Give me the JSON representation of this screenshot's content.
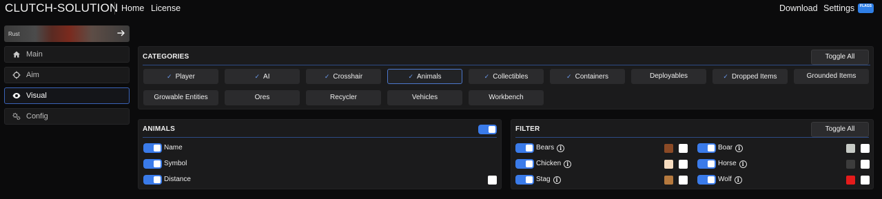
{
  "header": {
    "brand": "CLUTCH-SOLUTION",
    "nav_left": [
      "Home",
      "License"
    ],
    "nav_right": [
      "Download",
      "Settings"
    ],
    "language_flag_text": "FLAGS",
    "flag_color": "#2f7fe6"
  },
  "sidebar": {
    "game": {
      "name": "Rust",
      "action_icon": "arrow-right-icon"
    },
    "items": [
      {
        "label": "Main",
        "icon": "home-icon",
        "active": false
      },
      {
        "label": "Aim",
        "icon": "crosshair-icon",
        "active": false
      },
      {
        "label": "Visual",
        "icon": "eye-icon",
        "active": true
      },
      {
        "label": "Config",
        "icon": "gears-icon",
        "active": false
      }
    ]
  },
  "categories": {
    "title": "CATEGORIES",
    "toggle_all_label": "Toggle All",
    "items": [
      {
        "label": "Player",
        "checked": true,
        "selected": false
      },
      {
        "label": "AI",
        "checked": true,
        "selected": false
      },
      {
        "label": "Crosshair",
        "checked": true,
        "selected": false
      },
      {
        "label": "Animals",
        "checked": true,
        "selected": true
      },
      {
        "label": "Collectibles",
        "checked": true,
        "selected": false
      },
      {
        "label": "Containers",
        "checked": true,
        "selected": false
      },
      {
        "label": "Deployables",
        "checked": false,
        "selected": false
      },
      {
        "label": "Dropped Items",
        "checked": true,
        "selected": false
      },
      {
        "label": "Grounded Items",
        "checked": false,
        "selected": false
      },
      {
        "label": "Growable Entities",
        "checked": false,
        "selected": false
      },
      {
        "label": "Ores",
        "checked": false,
        "selected": false
      },
      {
        "label": "Recycler",
        "checked": false,
        "selected": false
      },
      {
        "label": "Vehicles",
        "checked": false,
        "selected": false
      },
      {
        "label": "Workbench",
        "checked": false,
        "selected": false
      }
    ]
  },
  "animals": {
    "title": "ANIMALS",
    "enabled": true,
    "options": [
      {
        "label": "Name",
        "enabled": true
      },
      {
        "label": "Symbol",
        "enabled": true
      },
      {
        "label": "Distance",
        "enabled": true,
        "checkbox": true
      }
    ]
  },
  "filter": {
    "title": "FILTER",
    "toggle_all_label": "Toggle All",
    "left": [
      {
        "label": "Bears",
        "enabled": true,
        "color": "#8b4a26"
      },
      {
        "label": "Chicken",
        "enabled": true,
        "color": "#f6dcc0"
      },
      {
        "label": "Stag",
        "enabled": true,
        "color": "#b5793e"
      }
    ],
    "right": [
      {
        "label": "Boar",
        "enabled": true,
        "color": "#c7cbc6"
      },
      {
        "label": "Horse",
        "enabled": true,
        "color": "#3c3c3c"
      },
      {
        "label": "Wolf",
        "enabled": true,
        "color": "#e51b1b"
      }
    ]
  },
  "colors": {
    "accent": "#3a7bea",
    "panel_bg": "#1b1b1c",
    "page_bg": "#0b0b0c"
  }
}
